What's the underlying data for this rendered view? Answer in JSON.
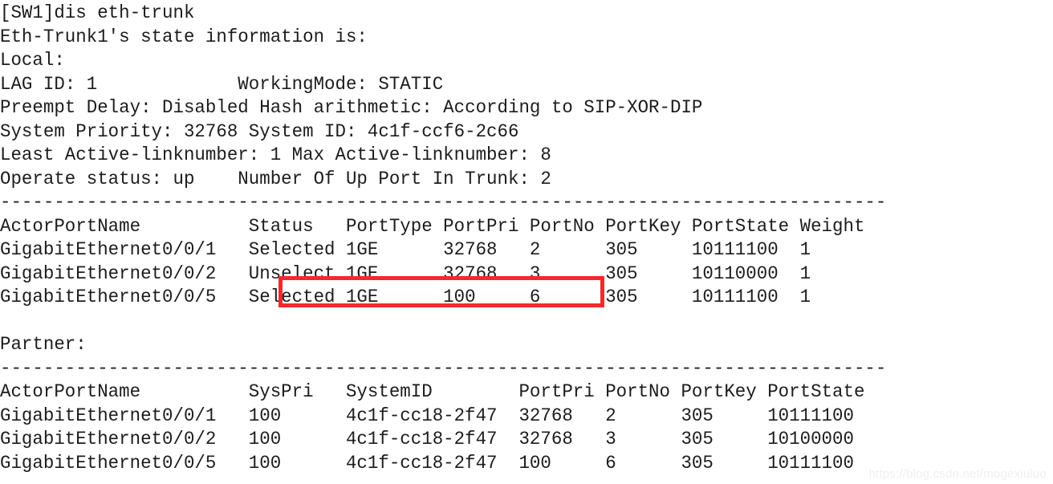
{
  "terminal": {
    "prompt_line": "[SW1]dis eth-trunk",
    "title_line": "Eth-Trunk1's state information is:",
    "local_heading": "Local:",
    "partner_heading": "Partner:",
    "separator": "--------------------------------------------------------------------------------",
    "blank": " "
  },
  "summary": {
    "lines": [
      {
        "left": "LAG ID: 1",
        "right": "WorkingMode: STATIC"
      },
      {
        "left": "Preempt Delay: Disabled",
        "right": "Hash arithmetic: According to SIP-XOR-DIP"
      },
      {
        "left": "System Priority: 32768",
        "right": "System ID: 4c1f-ccf6-2c66"
      },
      {
        "left": "Least Active-linknumber: 1",
        "right": "Max Active-linknumber: 8"
      },
      {
        "left": "Operate status: up",
        "right": "Number Of Up Port In Trunk: 2"
      }
    ],
    "fields": {
      "lag_id_label": "LAG ID:",
      "lag_id_value": "1",
      "working_mode_label": "WorkingMode:",
      "working_mode_value": "STATIC",
      "preempt_delay_label": "Preempt Delay:",
      "preempt_delay_value": "Disabled",
      "hash_arithmetic_label": "Hash arithmetic:",
      "hash_arithmetic_value": "According to SIP-XOR-DIP",
      "system_priority_label": "System Priority:",
      "system_priority_value": "32768",
      "system_id_label": "System ID:",
      "system_id_value": "4c1f-ccf6-2c66",
      "least_active_label": "Least Active-linknumber:",
      "least_active_value": "1",
      "max_active_label": "Max Active-linknumber:",
      "max_active_value": "8",
      "operate_status_label": "Operate status:",
      "operate_status_value": "up",
      "up_port_label": "Number Of Up Port In Trunk:",
      "up_port_value": "2"
    }
  },
  "local_table": {
    "headers": [
      "ActorPortName",
      "Status",
      "PortType",
      "PortPri",
      "PortNo",
      "PortKey",
      "PortState",
      "Weight"
    ],
    "header_line": "ActorPortName          Status   PortType PortPri PortNo PortKey PortState Weight",
    "rows": [
      {
        "line": "GigabitEthernet0/0/1   Selected 1GE      32768   2      305     10111100  1",
        "ActorPortName": "GigabitEthernet0/0/1",
        "Status": "Selected",
        "PortType": "1GE",
        "PortPri": "32768",
        "PortNo": "2",
        "PortKey": "305",
        "PortState": "10111100",
        "Weight": "1"
      },
      {
        "line": "GigabitEthernet0/0/2   Unselect 1GE      32768   3      305     10110000  1",
        "ActorPortName": "GigabitEthernet0/0/2",
        "Status": "Unselect",
        "PortType": "1GE",
        "PortPri": "32768",
        "PortNo": "3",
        "PortKey": "305",
        "PortState": "10110000",
        "Weight": "1"
      },
      {
        "line": "GigabitEthernet0/0/5   Selected 1GE      100     6      305     10111100  1",
        "ActorPortName": "GigabitEthernet0/0/5",
        "Status": "Selected",
        "PortType": "1GE",
        "PortPri": "100",
        "PortNo": "6",
        "PortKey": "305",
        "PortState": "10111100",
        "Weight": "1",
        "highlighted": true
      }
    ]
  },
  "partner_table": {
    "headers": [
      "ActorPortName",
      "SysPri",
      "SystemID",
      "PortPri",
      "PortNo",
      "PortKey",
      "PortState"
    ],
    "header_line": "ActorPortName          SysPri   SystemID        PortPri PortNo PortKey PortState",
    "rows": [
      {
        "line": "GigabitEthernet0/0/1   100      4c1f-cc18-2f47  32768   2      305     10111100",
        "ActorPortName": "GigabitEthernet0/0/1",
        "SysPri": "100",
        "SystemID": "4c1f-cc18-2f47",
        "PortPri": "32768",
        "PortNo": "2",
        "PortKey": "305",
        "PortState": "10111100"
      },
      {
        "line": "GigabitEthernet0/0/2   100      4c1f-cc18-2f47  32768   3      305     10100000",
        "ActorPortName": "GigabitEthernet0/0/2",
        "SysPri": "100",
        "SystemID": "4c1f-cc18-2f47",
        "PortPri": "32768",
        "PortNo": "3",
        "PortKey": "305",
        "PortState": "10100000"
      },
      {
        "line": "GigabitEthernet0/0/5   100      4c1f-cc18-2f47  100     6      305     10111100",
        "ActorPortName": "GigabitEthernet0/0/5",
        "SysPri": "100",
        "SystemID": "4c1f-cc18-2f47",
        "PortPri": "100",
        "PortNo": "6",
        "PortKey": "305",
        "PortState": "10111100"
      }
    ]
  },
  "annotation": {
    "highlight_color": "#f6282d",
    "highlight_target": "GigabitEthernet0/0/5 Selected 1GE 100"
  },
  "watermark": {
    "text": "https://blog.csdn.net/mogexiuluo",
    "color": "#efefef"
  }
}
